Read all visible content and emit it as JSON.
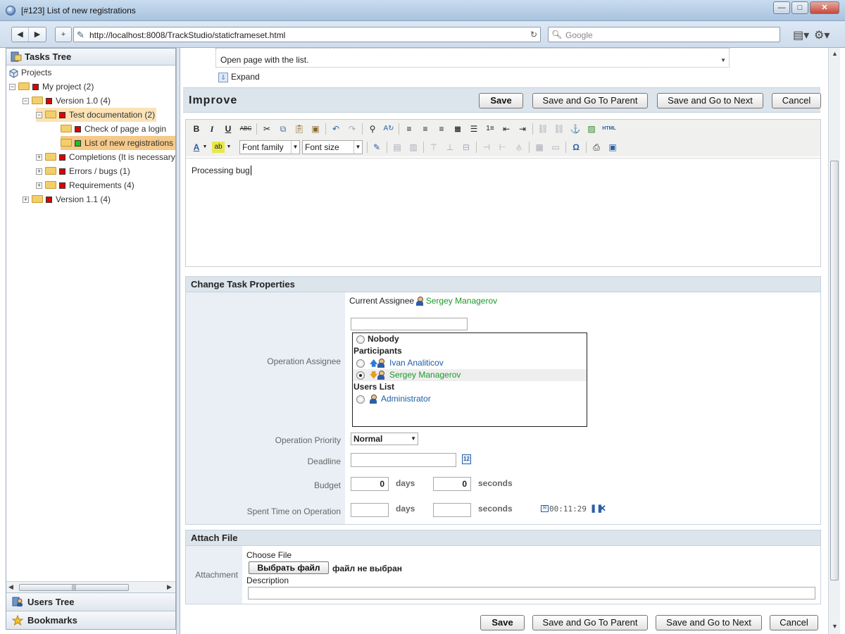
{
  "window": {
    "title": "[#123] List of new registrations"
  },
  "browser": {
    "url": "http://localhost:8008/TrackStudio/staticframeset.html",
    "search_placeholder": "Google"
  },
  "sidebar": {
    "tasks_tree_title": "Tasks Tree",
    "items": [
      {
        "label": "Projects"
      },
      {
        "label": "My project (2)"
      },
      {
        "label": "Version 1.0 (4)"
      },
      {
        "label": "Test documentation (2)"
      },
      {
        "label": "Check of page a login"
      },
      {
        "label": "List of new registrations"
      },
      {
        "label": "Completions (It is necessary"
      },
      {
        "label": "Errors / bugs (1)"
      },
      {
        "label": "Requirements (4)"
      },
      {
        "label": "Version 1.1 (4)"
      }
    ],
    "users_tree_title": "Users Tree",
    "bookmarks_title": "Bookmarks"
  },
  "description": {
    "text": "Open page with the list.",
    "expand_label": "Expand"
  },
  "operation": {
    "title": "Improve",
    "save": "Save",
    "save_parent": "Save and Go To Parent",
    "save_next": "Save and Go to Next",
    "cancel": "Cancel"
  },
  "editor": {
    "font_family": "Font family",
    "font_size": "Font size",
    "html_label": "HTML",
    "content": "Processing bug"
  },
  "properties": {
    "section_title": "Change Task Properties",
    "current_assignee_label": "Current Assignee",
    "current_assignee": "Sergey Managerov",
    "operation_assignee_label": "Operation Assignee",
    "nobody": "Nobody",
    "participants_header": "Participants",
    "participants": [
      "Ivan Analiticov",
      "Sergey Managerov"
    ],
    "users_list_header": "Users List",
    "users": [
      "Administrator"
    ],
    "priority_label": "Operation Priority",
    "priority_value": "Normal",
    "deadline_label": "Deadline",
    "budget_label": "Budget",
    "budget_days": "0",
    "budget_seconds": "0",
    "days_unit": "days",
    "seconds_unit": "seconds",
    "spent_label": "Spent Time on Operation",
    "timer": "00:11:29"
  },
  "attach": {
    "section_title": "Attach File",
    "attachment_label": "Attachment",
    "choose_file": "Choose File",
    "choose_button": "Выбрать файл",
    "no_file": "файл не выбран",
    "description_label": "Description"
  }
}
